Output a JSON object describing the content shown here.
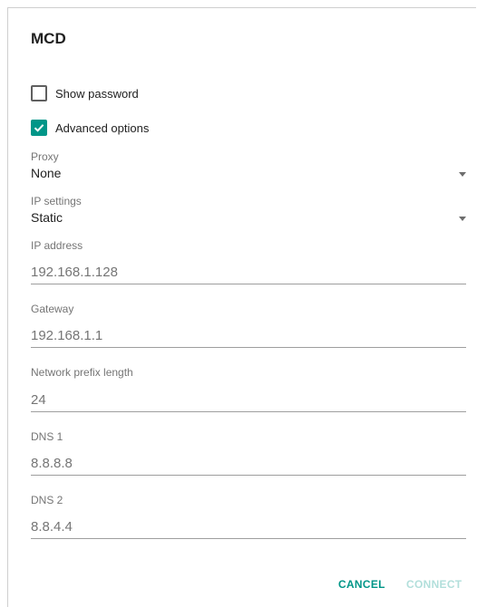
{
  "dialog": {
    "title": "MCD",
    "show_password": {
      "label": "Show password",
      "checked": false
    },
    "advanced_options": {
      "label": "Advanced options",
      "checked": true
    },
    "proxy": {
      "label": "Proxy",
      "value": "None"
    },
    "ip_settings": {
      "label": "IP settings",
      "value": "Static"
    },
    "ip_address": {
      "label": "IP address",
      "value": "192.168.1.128"
    },
    "gateway": {
      "label": "Gateway",
      "value": "192.168.1.1"
    },
    "prefix_length": {
      "label": "Network prefix length",
      "value": "24"
    },
    "dns1": {
      "label": "DNS 1",
      "value": "8.8.8.8"
    },
    "dns2": {
      "label": "DNS 2",
      "value": "8.8.4.4"
    },
    "buttons": {
      "cancel": "CANCEL",
      "connect": "CONNECT"
    }
  },
  "colors": {
    "accent": "#009688",
    "accent_disabled": "#b2dfdb"
  },
  "icons": {
    "checkmark": "check-icon",
    "dropdown": "dropdown-arrow-icon"
  }
}
